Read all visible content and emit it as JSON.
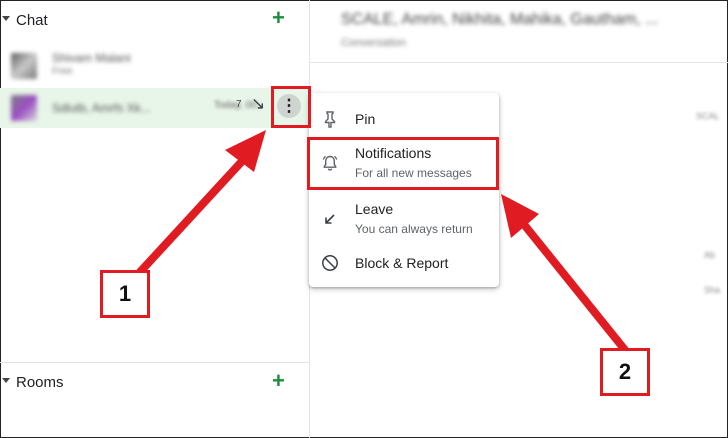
{
  "sidebar": {
    "chat_section": {
      "label": "Chat",
      "add_label": "+"
    },
    "rooms_section": {
      "label": "Rooms",
      "add_label": "+"
    },
    "chats": [
      {
        "title": "Shivam Malani",
        "subtitle": "Free"
      },
      {
        "title": "Sdlutb, Amrfs Xk...",
        "time": "Today, 00:",
        "badge": "7",
        "selected": true
      }
    ]
  },
  "conversation": {
    "title": "SCALE, Amrin, Nikhita, Mahika, Gautham, ...",
    "subtitle": "Conversation",
    "fragments": [
      "SCAL",
      "Ab",
      "Sha"
    ]
  },
  "context_menu": {
    "items": [
      {
        "label": "Pin",
        "icon": "pin-icon"
      },
      {
        "label": "Notifications",
        "sublabel": "For all new messages",
        "icon": "bell-icon"
      },
      {
        "label": "Leave",
        "sublabel": "You can always return",
        "icon": "leave-arrow-icon"
      },
      {
        "label": "Block & Report",
        "icon": "block-icon"
      }
    ]
  },
  "annotations": {
    "step1": "1",
    "step2": "2",
    "color": "#e11b22"
  },
  "colors": {
    "accent": "#1e8e3e",
    "selected_row": "#e8f5e9",
    "annotation": "#e11b22"
  }
}
